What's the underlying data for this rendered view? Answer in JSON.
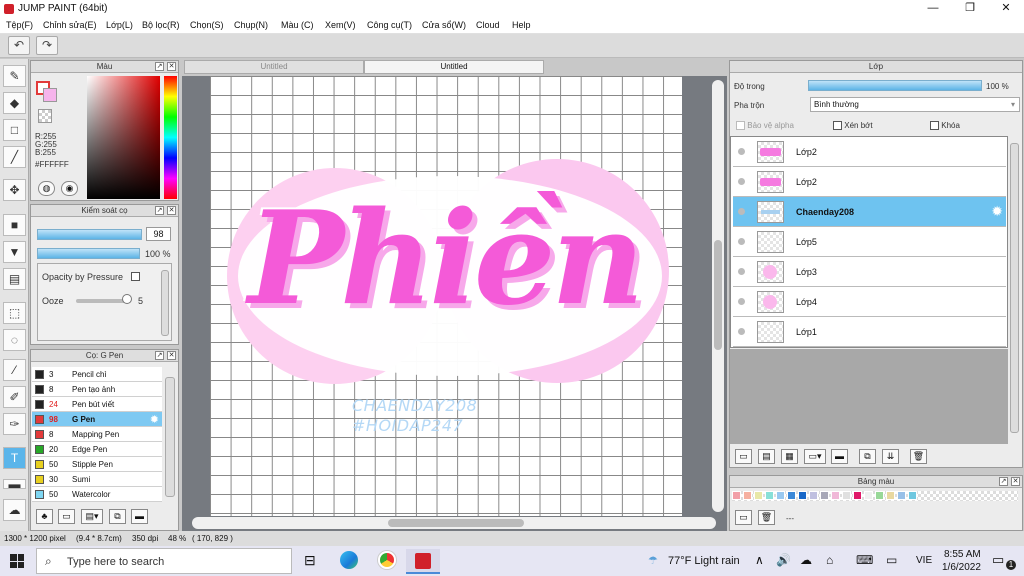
{
  "window": {
    "title": "JUMP PAINT (64bit)"
  },
  "menu": [
    "Tệp(F)",
    "Chỉnh sửa(E)",
    "Lớp(L)",
    "Bộ lọc(R)",
    "Chọn(S)",
    "Chụp(N)",
    "Màu (C)",
    "Xem(V)",
    "Công cụ(T)",
    "Cửa sổ(W)",
    "Cloud",
    "Help"
  ],
  "color_panel": {
    "title": "Màu",
    "r": "R:255",
    "g": "G:255",
    "b": "B:255",
    "hex": "#FFFFFF"
  },
  "brush_control": {
    "title": "Kiểm soát cọ",
    "size": "98",
    "opacity": "100 %",
    "opacity_label": "Opacity by Pressure",
    "ooze_label": "Ooze",
    "ooze_value": "5"
  },
  "brush_list": {
    "title": "Cọ: G Pen",
    "items": [
      {
        "size": "3",
        "name": "Pencil chì",
        "color": "#222222"
      },
      {
        "size": "8",
        "name": "Pen tạo ảnh",
        "color": "#222222"
      },
      {
        "size": "24",
        "name": "Pen bút viết",
        "color": "#222222"
      },
      {
        "size": "98",
        "name": "G Pen",
        "color": "#e23a3a",
        "selected": true
      },
      {
        "size": "8",
        "name": "Mapping Pen",
        "color": "#e23a3a"
      },
      {
        "size": "20",
        "name": "Edge Pen",
        "color": "#28a828"
      },
      {
        "size": "50",
        "name": "Stipple Pen",
        "color": "#e8d020"
      },
      {
        "size": "30",
        "name": "Sumi",
        "color": "#e8d020"
      },
      {
        "size": "50",
        "name": "Watercolor",
        "color": "#7fd6f2"
      }
    ]
  },
  "tabs": [
    "Untitled",
    "Untitled"
  ],
  "canvas_art": {
    "word": "Phiền",
    "credit1": "CHAENDAY208",
    "credit2": "#HOIDAP247"
  },
  "layer_panel": {
    "title": "Lớp",
    "opacity_label": "Độ trong",
    "opacity_value": "100 %",
    "blend_label": "Pha trộn",
    "blend_value": "Bình thường",
    "protect_alpha": "Bảo vệ alpha",
    "clipping": "Xén bớt",
    "lock": "Khóa",
    "layers": [
      {
        "name": "Lớp2",
        "thumb": "text"
      },
      {
        "name": "Lớp2",
        "thumb": "text"
      },
      {
        "name": "Chaenday208",
        "thumb": "credit",
        "selected": true
      },
      {
        "name": "Lớp5",
        "thumb": "blank"
      },
      {
        "name": "Lớp3",
        "thumb": "circle"
      },
      {
        "name": "Lớp4",
        "thumb": "circle"
      },
      {
        "name": "Lớp1",
        "thumb": "blank"
      }
    ]
  },
  "palette": {
    "title": "Bảng màu",
    "dash": "---",
    "swatches": [
      "#f2a0a8",
      "#f6b0a0",
      "#e8e8a8",
      "#88e0d8",
      "#98c8f0",
      "#3a88d8",
      "#1868c8",
      "#c0c0e0",
      "#a8a8b8",
      "#f0b8d8",
      "#e0e0e0",
      "#e01868",
      "#f0f0f0",
      "#98d898",
      "#e8d8a0",
      "#98c0e8",
      "#70c8e0"
    ]
  },
  "status": {
    "size": "1300 * 1200 pixel",
    "dims": "(9.4 * 8.7cm)",
    "dpi": "350 dpi",
    "zoom": "48 %",
    "coords": "( 170, 829 )"
  },
  "taskbar": {
    "search": "Type here to search",
    "weather": "77°F  Light rain",
    "lang": "VIE",
    "time": "8:55 AM",
    "date": "1/6/2022",
    "notif": "1"
  }
}
